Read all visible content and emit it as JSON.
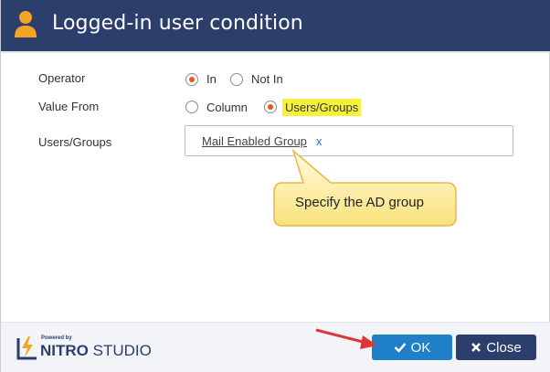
{
  "dialog": {
    "title": "Logged-in user condition",
    "icon": "user-icon"
  },
  "form": {
    "operator": {
      "label": "Operator",
      "options": [
        "In",
        "Not In"
      ],
      "selected": "In"
    },
    "value_from": {
      "label": "Value From",
      "options": [
        "Column",
        "Users/Groups"
      ],
      "selected": "Users/Groups"
    },
    "users_groups": {
      "label": "Users/Groups",
      "tag": "Mail Enabled Group",
      "remove": "x"
    }
  },
  "callout": {
    "text": "Specify the AD group"
  },
  "footer": {
    "brand_small": "Powered by",
    "brand_name_bold": "NITRO",
    "brand_name_rest": " STUDIO",
    "ok_label": "OK",
    "close_label": "Close"
  },
  "colors": {
    "header": "#2c3e6b",
    "ok_button": "#1f7fc9",
    "close_button": "#2c3e6b",
    "radio_selected": "#e8571c",
    "highlight": "#f6f23a",
    "callout": "#fdf0a8",
    "annotation_arrow": "#e0333a"
  }
}
